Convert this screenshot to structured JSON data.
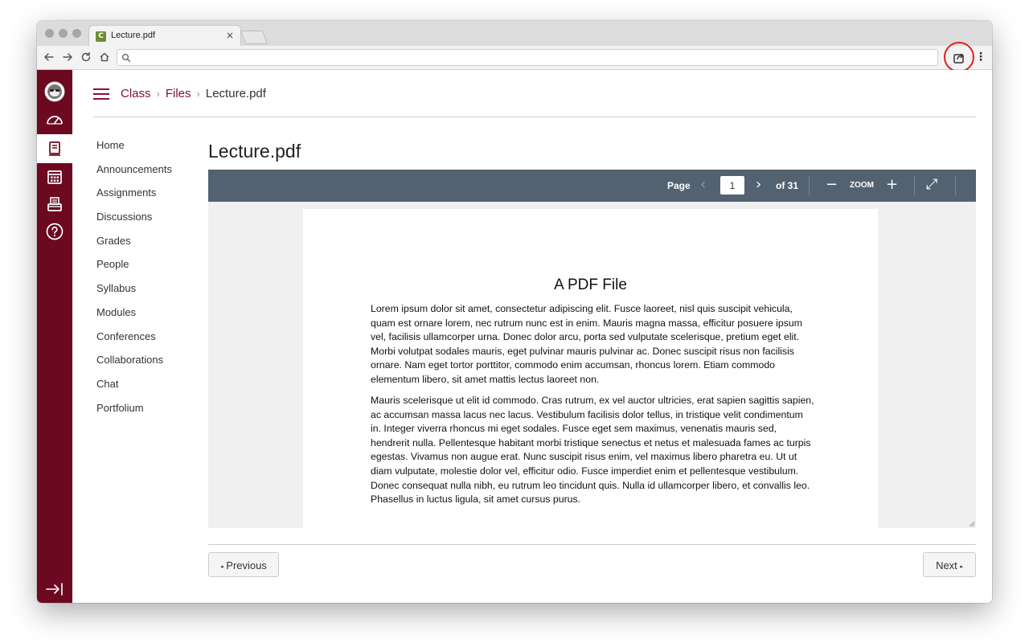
{
  "browser": {
    "tab_title": "Lecture.pdf",
    "tab_close": "×",
    "favicon_letter": "C",
    "address_value": ""
  },
  "icons": {
    "back": "arrow-left-icon",
    "forward": "arrow-right-icon",
    "reload": "reload-icon",
    "home": "home-icon",
    "search": "search-icon",
    "share": "share-icon",
    "menu": "kebab-menu-icon"
  },
  "colors": {
    "global_nav": "#6c0921",
    "link": "#7d1231",
    "pdf_toolbar": "#536271",
    "highlight_ring": "#e0201c"
  },
  "global_nav": [
    {
      "id": "account",
      "icon": "user-avatar-icon"
    },
    {
      "id": "dashboard",
      "icon": "dashboard-icon"
    },
    {
      "id": "courses",
      "icon": "courses-icon",
      "active": true
    },
    {
      "id": "calendar",
      "icon": "calendar-icon"
    },
    {
      "id": "inbox",
      "icon": "inbox-icon"
    },
    {
      "id": "help",
      "icon": "help-icon"
    },
    {
      "id": "collapse",
      "icon": "collapse-nav-icon"
    }
  ],
  "breadcrumb": {
    "items": [
      "Class",
      "Files",
      "Lecture.pdf"
    ],
    "separator": "›"
  },
  "course_nav": [
    "Home",
    "Announcements",
    "Assignments",
    "Discussions",
    "Grades",
    "People",
    "Syllabus",
    "Modules",
    "Conferences",
    "Collaborations",
    "Chat",
    "Portfolium"
  ],
  "page_title": "Lecture.pdf",
  "pdf_toolbar": {
    "page_label": "Page",
    "current_page": "1",
    "of_label": "of 31",
    "zoom_label": "ZOOM",
    "prev_glyph": "‹",
    "next_glyph": "›",
    "minus_glyph": "−",
    "plus_glyph": "+",
    "fullscreen_glyph": "⤢"
  },
  "pdf": {
    "heading": "A PDF File",
    "paragraphs": [
      "Lorem ipsum dolor sit amet, consectetur adipiscing elit. Fusce laoreet, nisl quis suscipit vehicula, quam est ornare lorem, nec rutrum nunc est in enim. Mauris magna massa, efficitur posuere ipsum vel, facilisis ullamcorper urna. Donec dolor arcu, porta sed vulputate scelerisque, pretium eget elit. Morbi volutpat sodales mauris, eget pulvinar mauris pulvinar ac. Donec suscipit risus non facilisis ornare. Nam eget tortor porttitor, commodo enim accumsan, rhoncus lorem. Etiam commodo elementum libero, sit amet mattis lectus laoreet non.",
      "Mauris scelerisque ut elit id commodo. Cras rutrum, ex vel auctor ultricies, erat sapien sagittis sapien, ac accumsan massa lacus nec lacus. Vestibulum facilisis dolor tellus, in tristique velit condimentum in. Integer viverra rhoncus mi eget sodales. Fusce eget sem maximus, venenatis mauris sed, hendrerit nulla. Pellentesque habitant morbi tristique senectus et netus et malesuada fames ac turpis egestas. Vivamus non augue erat. Nunc suscipit risus enim, vel maximus libero pharetra eu. Ut ut diam vulputate, molestie dolor vel, efficitur odio. Fusce imperdiet enim et pellentesque vestibulum. Donec consequat nulla nibh, eu rutrum leo tincidunt quis. Nulla id ullamcorper libero, et convallis leo. Phasellus in luctus ligula, sit amet cursus purus."
    ]
  },
  "footer": {
    "previous_label": "Previous",
    "next_label": "Next",
    "previous_glyph": "◂",
    "next_glyph": "▸"
  }
}
